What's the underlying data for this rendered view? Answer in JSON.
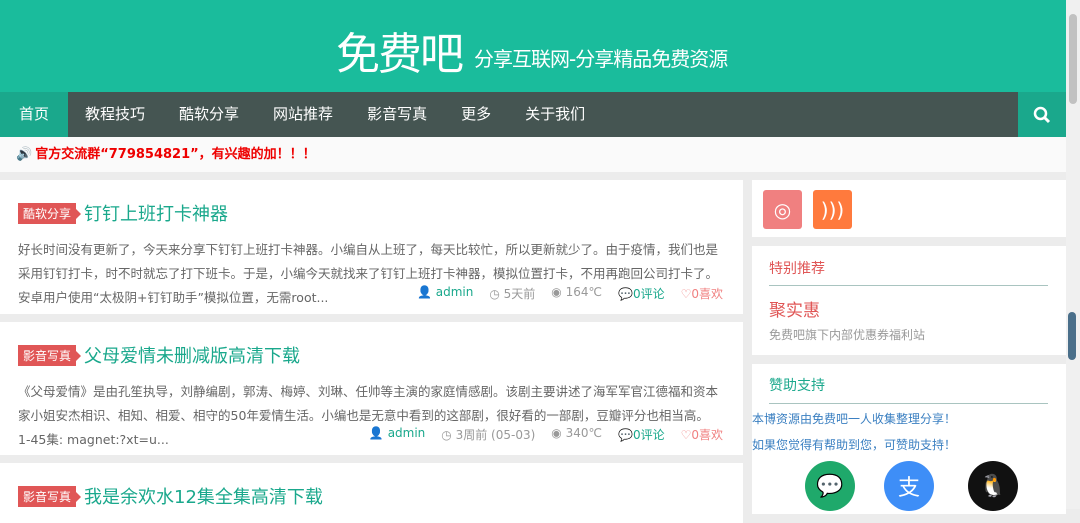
{
  "header": {
    "logo": "免费吧",
    "slogan": "分享互联网-分享精品免费资源"
  },
  "nav": {
    "items": [
      "首页",
      "教程技巧",
      "酷软分享",
      "网站推荐",
      "影音写真",
      "更多",
      "关于我们"
    ]
  },
  "notice": "官方交流群“779854821”，有兴趣的加！！！",
  "posts": [
    {
      "tag": "酷软分享",
      "title": "钉钉上班打卡神器",
      "excerpt": "好长时间没有更新了，今天来分享下钉钉上班打卡神器。小编自从上班了，每天比较忙，所以更新就少了。由于疫情，我们也是采用钉钉打卡，时不时就忘了打下班卡。于是，小编今天就找来了钉钉上班打卡神器，模拟位置打卡，不用再跑回公司打卡了。安卓用户使用“太极阴+钉钉助手”模拟位置，无需root...",
      "author": "admin",
      "time": "5天前",
      "views": "164℃",
      "comments": "0评论",
      "likes": "0喜欢"
    },
    {
      "tag": "影音写真",
      "title": "父母爱情未删减版高清下载",
      "excerpt": "《父母爱情》是由孔笙执导，刘静编剧，郭涛、梅婷、刘琳、任帅等主演的家庭情感剧。该剧主要讲述了海军军官江德福和资本家小姐安杰相识、相知、相爱、相守的50年爱情生活。小编也是无意中看到的这部剧，很好看的一部剧，豆瓣评分也相当高。 1-45集: magnet:?xt=u...",
      "author": "admin",
      "time": "3周前 (05-03)",
      "views": "340℃",
      "comments": "0评论",
      "likes": "0喜欢"
    },
    {
      "tag": "影音写真",
      "title": "我是余欢水12集全集高清下载"
    }
  ],
  "sidebar": {
    "special_title": "特别推荐",
    "special_name": "聚实惠",
    "special_desc": "免费吧旗下内部优惠券福利站",
    "sponsor_title": "赞助支持",
    "sponsor_line1": "本博资源由免费吧一人收集整理分享！",
    "sponsor_line2": "如果您觉得有帮助到您，可赞助支持！"
  },
  "colors": {
    "brand": "#1abc9c",
    "nav": "#455552",
    "tag": "#e05656"
  }
}
